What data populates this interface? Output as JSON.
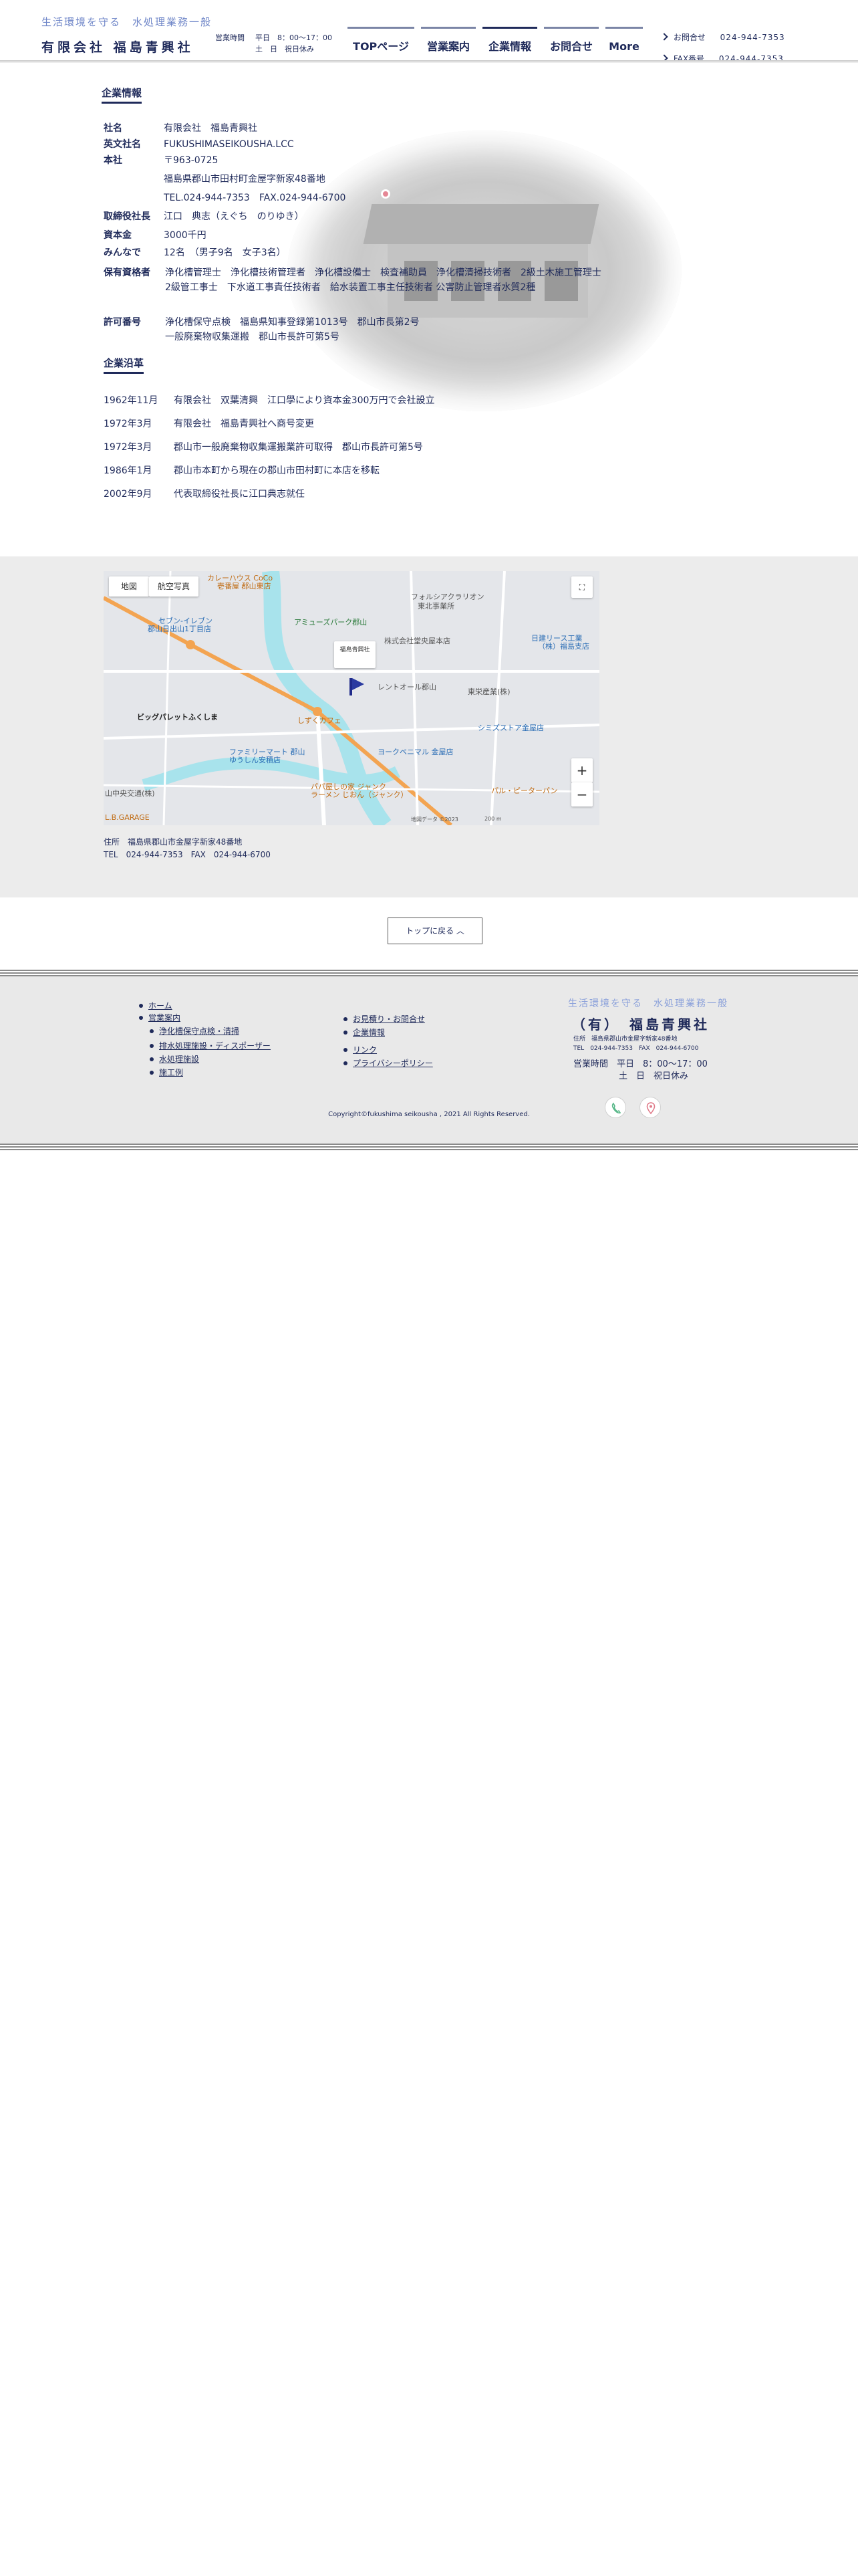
{
  "header": {
    "tagline": "生活環境を守る　水処理業務一般",
    "company": "有限会社 福島青興社",
    "hours_label": "営業時間",
    "hours_line1": "平日　8：00〜17：00",
    "hours_line2": "土　日　祝日休み",
    "nav": [
      "TOPページ",
      "営業案内",
      "企業情報",
      "お問合せ",
      "More"
    ],
    "nav_active": "企業情報",
    "contact_label": "お問合せ",
    "contact_tel": "024-944-7353",
    "fax_label": "FAX番号",
    "fax_tel": "024-944-7353"
  },
  "company_info": {
    "title": "企業情報",
    "rows": [
      {
        "k": "社名",
        "v": "有限会社　福島青興社"
      },
      {
        "k": "英文社名",
        "v": "FUKUSHIMASEIKOUSHA.LCC"
      },
      {
        "k": "本社",
        "v": "〒963-0725"
      },
      {
        "k": "",
        "v": "福島県郡山市田村町金屋字新家48番地"
      },
      {
        "k": "",
        "v": "TEL.024-944-7353　FAX.024-944-6700"
      },
      {
        "k": "取締役社長",
        "v": "江口　典志（えぐち　のりゆき）"
      },
      {
        "k": "資本金",
        "v": "3000千円"
      },
      {
        "k": "みんなで",
        "v": "12名　（男子9名　女子3名）"
      },
      {
        "k": "保有資格者",
        "v": "浄化槽管理士　浄化槽技術管理者　浄化槽設備士　検査補助員　浄化槽清掃技術者　2級土木施工管理士"
      },
      {
        "k": "",
        "v": "2級管工事士　下水道工事責任技術者　給水装置工事主任技術者 公害防止管理者水質2種"
      },
      {
        "k": "許可番号",
        "v": "浄化槽保守点検　福島県知事登録第1013号　郡山市長第2号"
      },
      {
        "k": "",
        "v": "一般廃棄物収集運搬　郡山市長許可第5号"
      }
    ]
  },
  "history": {
    "title": "企業沿革",
    "rows": [
      {
        "y": "1962年11月",
        "t": "有限会社　双葉清興　江口學により資本金300万円で会社設立"
      },
      {
        "y": "1972年3月",
        "t": "有限会社　福島青興社へ商号変更"
      },
      {
        "y": "1972年3月",
        "t": "郡山市一般廃棄物収集運搬業許可取得　郡山市長許可第5号"
      },
      {
        "y": "1986年1月",
        "t": "郡山市本町から現在の郡山市田村町に本店を移転"
      },
      {
        "y": "2002年9月",
        "t": "代表取締役社長に江口典志就任"
      }
    ]
  },
  "map": {
    "type_map": "地図",
    "type_satellite": "航空写真",
    "labels": [
      {
        "t": "カレーハウス CoCo",
        "c": "orange"
      },
      {
        "t": "壱番屋 郡山東店",
        "c": "orange"
      },
      {
        "t": "フォルシアクラリオン",
        "c": "gray"
      },
      {
        "t": "東北事業所",
        "c": "gray"
      },
      {
        "t": "セブン-イレブン",
        "c": "blue"
      },
      {
        "t": "郡山日出山1丁目店",
        "c": "blue"
      },
      {
        "t": "アミューズパーク郡山",
        "c": "green"
      },
      {
        "t": "株式会社堂央屋本店",
        "c": "gray"
      },
      {
        "t": "日建リース工業",
        "c": "blue"
      },
      {
        "t": "（株）福島支店",
        "c": "blue"
      },
      {
        "t": "レントオール郡山",
        "c": "gray"
      },
      {
        "t": "東栄産業(株)",
        "c": "gray"
      },
      {
        "t": "ビッグパレットふくしま",
        "c": "black"
      },
      {
        "t": "しずくカフェ",
        "c": "orange"
      },
      {
        "t": "シミズストア金屋店",
        "c": "blue"
      },
      {
        "t": "ファミリーマート 郡山",
        "c": "blue"
      },
      {
        "t": "ゆうしん安積店",
        "c": "blue"
      },
      {
        "t": "ヨークベニマル 金屋店",
        "c": "blue"
      },
      {
        "t": "パパ屋しの家 ジャンク",
        "c": "orange"
      },
      {
        "t": "ラーメン じおん（ジャンク）",
        "c": "orange"
      },
      {
        "t": "パル・ピーターパン",
        "c": "orange"
      },
      {
        "t": "山中央交通(株)",
        "c": "gray"
      },
      {
        "t": "L.B.GARAGE",
        "c": "orange"
      },
      {
        "t": "地図データ ©2023",
        "c": "gray"
      },
      {
        "t": "200 m",
        "c": "gray"
      }
    ],
    "marker_popup": "福島青興社"
  },
  "address": {
    "line1": "住所　福島県郡山市金屋字新家48番地",
    "line2": "TEL　024-944-7353　FAX　024-944-6700"
  },
  "top_button": "トップに戻る ︿",
  "footer": {
    "menu_left": [
      {
        "label": "ホーム",
        "sub": false
      },
      {
        "label": "営業案内",
        "sub": false
      },
      {
        "label": "浄化槽保守点検・清掃",
        "sub": true
      },
      {
        "label": "排水処理施設・ディスポーザー",
        "sub": true
      },
      {
        "label": "水処理施設",
        "sub": true
      },
      {
        "label": "施工例",
        "sub": true
      }
    ],
    "menu_right": [
      {
        "label": "お見積り・お問合せ"
      },
      {
        "label": "企業情報"
      },
      {
        "label": "リンク"
      },
      {
        "label": "プライバシーポリシー"
      }
    ],
    "brand_tag": "生活環境を守る　水処理業務一般",
    "brand_name": "（有）　福島青興社",
    "brand_addr": "住所　福島県郡山市金屋字新家48番地",
    "brand_tel": "TEL　024-944-7353　FAX　024-944-6700",
    "brand_hours1": "営業時間　平日　8：00〜17：00",
    "brand_hours2": "土　日　祝日休み",
    "copyright": "Copyright©fukushima seikousha , 2021 All Rights Reserved.",
    "icons": [
      "phone-icon",
      "map-pin-icon"
    ]
  }
}
